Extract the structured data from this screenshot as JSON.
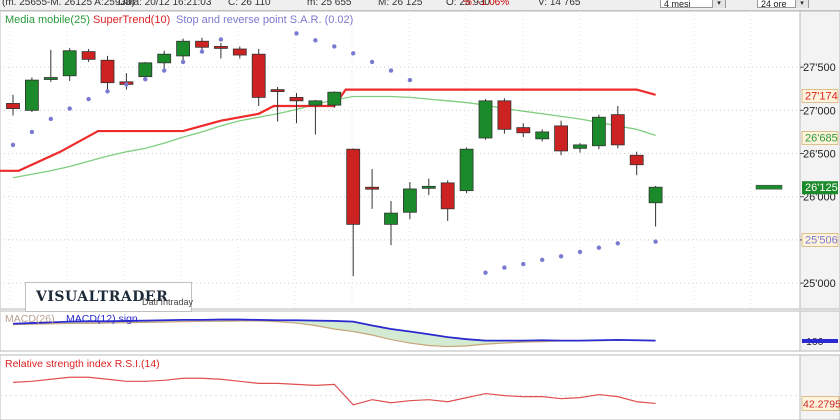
{
  "toolbar": {
    "quote": "(m. 25655-M. 26125 A:25930)",
    "date": "Data: 20/12 16:21:03",
    "close": "C: 26 110",
    "min": "m: 25 655",
    "max": "M: 26 125",
    "open": "O: 25 930",
    "change": "%: -1.06%",
    "volume": "V: 14 765",
    "period_select": "4 mesi",
    "interval_select": "24 ore"
  },
  "brand": {
    "logo": "VISUALTRADER",
    "data_source": "Dati Intraday"
  },
  "colors": {
    "up": "#1a8a2a",
    "down": "#cc2222",
    "ma": "#7fce7f",
    "supertrend": "#ee2a2a",
    "sar": "#7a7ad0",
    "macd": "#2a2ad0",
    "signal": "#c8a57a",
    "rsi": "#e05050",
    "hist": "#bfe3bf"
  },
  "chart_data": {
    "type": "candlestick",
    "legend": [
      {
        "name": "Media mobile(25)",
        "color": "#2a9a3a"
      },
      {
        "name": "SuperTrend(10)",
        "color": "#dd2222"
      },
      {
        "name": "Stop and reverse point S.A.R. (0.02)",
        "color": "#7a7ad0"
      }
    ],
    "y_ticks": [
      25000,
      25500,
      26000,
      26500,
      27000,
      27500
    ],
    "y_tick_labels": [
      "25'000",
      "",
      "26'000",
      "26'500",
      "27'000",
      "27'500"
    ],
    "ylim": [
      24700,
      28150
    ],
    "candles": [
      {
        "o": 27080,
        "h": 27180,
        "l": 26940,
        "c": 27020
      },
      {
        "o": 27000,
        "h": 27380,
        "l": 26980,
        "c": 27350
      },
      {
        "o": 27360,
        "h": 27700,
        "l": 27330,
        "c": 27380
      },
      {
        "o": 27400,
        "h": 27720,
        "l": 27340,
        "c": 27690
      },
      {
        "o": 27680,
        "h": 27710,
        "l": 27560,
        "c": 27590
      },
      {
        "o": 27580,
        "h": 27630,
        "l": 27220,
        "c": 27320
      },
      {
        "o": 27330,
        "h": 27430,
        "l": 27240,
        "c": 27300
      },
      {
        "o": 27390,
        "h": 27560,
        "l": 27380,
        "c": 27550
      },
      {
        "o": 27550,
        "h": 27690,
        "l": 27480,
        "c": 27650
      },
      {
        "o": 27630,
        "h": 27830,
        "l": 27580,
        "c": 27800
      },
      {
        "o": 27800,
        "h": 27840,
        "l": 27700,
        "c": 27730
      },
      {
        "o": 27740,
        "h": 27780,
        "l": 27600,
        "c": 27720
      },
      {
        "o": 27710,
        "h": 27740,
        "l": 27600,
        "c": 27640
      },
      {
        "o": 27650,
        "h": 27710,
        "l": 27050,
        "c": 27150
      },
      {
        "o": 27240,
        "h": 27270,
        "l": 26870,
        "c": 27220
      },
      {
        "o": 27150,
        "h": 27200,
        "l": 26850,
        "c": 27110
      },
      {
        "o": 27060,
        "h": 27120,
        "l": 26720,
        "c": 27110
      },
      {
        "o": 27060,
        "h": 27220,
        "l": 27030,
        "c": 27210
      },
      {
        "o": 26550,
        "h": 26560,
        "l": 25080,
        "c": 25680
      },
      {
        "o": 26110,
        "h": 26320,
        "l": 25860,
        "c": 26090
      },
      {
        "o": 25680,
        "h": 25950,
        "l": 25440,
        "c": 25810
      },
      {
        "o": 25820,
        "h": 26170,
        "l": 25740,
        "c": 26090
      },
      {
        "o": 26110,
        "h": 26210,
        "l": 26020,
        "c": 26120
      },
      {
        "o": 26160,
        "h": 26190,
        "l": 25720,
        "c": 25860
      },
      {
        "o": 26070,
        "h": 26570,
        "l": 26040,
        "c": 26550
      },
      {
        "o": 26680,
        "h": 27130,
        "l": 26660,
        "c": 27110
      },
      {
        "o": 27110,
        "h": 27140,
        "l": 26730,
        "c": 26780
      },
      {
        "o": 26800,
        "h": 26850,
        "l": 26690,
        "c": 26740
      },
      {
        "o": 26670,
        "h": 26780,
        "l": 26640,
        "c": 26750
      },
      {
        "o": 26820,
        "h": 26880,
        "l": 26480,
        "c": 26530
      },
      {
        "o": 26560,
        "h": 26620,
        "l": 26510,
        "c": 26600
      },
      {
        "o": 26590,
        "h": 26950,
        "l": 26550,
        "c": 26920
      },
      {
        "o": 26950,
        "h": 27050,
        "l": 26560,
        "c": 26600
      },
      {
        "o": 26480,
        "h": 26520,
        "l": 26250,
        "c": 26370
      },
      {
        "o": 25930,
        "h": 26125,
        "l": 25655,
        "c": 26110
      }
    ],
    "moving_average": [
      26220,
      26260,
      26300,
      26350,
      26410,
      26470,
      26520,
      26560,
      26620,
      26690,
      26750,
      26820,
      26880,
      26920,
      26960,
      27010,
      27070,
      27120,
      27160,
      27160,
      27160,
      27150,
      27130,
      27110,
      27090,
      27060,
      27020,
      26990,
      26960,
      26930,
      26900,
      26860,
      26820,
      26780,
      26710
    ],
    "supertrend": [
      26300,
      26300,
      26520,
      26760,
      26760,
      26760,
      26760,
      26760,
      26760,
      26760,
      26760,
      26760,
      26880,
      26960,
      26960,
      26960,
      27050,
      27050,
      27050,
      27050,
      27050,
      27050,
      27050,
      27050,
      27050,
      27050,
      27050,
      27240,
      27240,
      27240,
      27240,
      27240,
      27240,
      27240,
      27240,
      27240,
      27180
    ],
    "supertrend_x": [
      0,
      0.7,
      3.5,
      5.5,
      6,
      7,
      8,
      9,
      10,
      11,
      11.4,
      12,
      13,
      14,
      15,
      16,
      17,
      17.5,
      18,
      19,
      20,
      21,
      22,
      23,
      24,
      25,
      17.4,
      17.6,
      19,
      21,
      23,
      25,
      27,
      29,
      31,
      33,
      34
    ],
    "sar": [
      26600,
      26750,
      26900,
      27020,
      27130,
      27220,
      27300,
      27360,
      27460,
      27560,
      27680,
      27820,
      27890,
      27810,
      27740,
      27660,
      27560,
      27460,
      27350,
      25120,
      25180,
      25220,
      25270,
      25310,
      25360,
      25410,
      25460,
      25480
    ],
    "sar_x": [
      0,
      1,
      2,
      3,
      4,
      5,
      6,
      7,
      8,
      9,
      10,
      11,
      15,
      16,
      17,
      18,
      19,
      20,
      21,
      25,
      26,
      27,
      28,
      29,
      30,
      31,
      32,
      34
    ],
    "last_label": "26'125",
    "price_tags": [
      {
        "value": 27174,
        "label": "27'174",
        "color": "#dd2222"
      },
      {
        "value": 26685,
        "label": "26'685",
        "color": "#2a9a3a"
      },
      {
        "value": 25506,
        "label": "25'506",
        "color": "#7a7ad0"
      }
    ],
    "macd_panel": {
      "legend_a": "MACD(26)",
      "legend_b": "MACD(12) sign",
      "tick_label": "100",
      "macd": [
        0.6,
        0.62,
        0.64,
        0.66,
        0.67,
        0.67,
        0.68,
        0.69,
        0.7,
        0.71,
        0.71,
        0.72,
        0.72,
        0.71,
        0.7,
        0.7,
        0.69,
        0.68,
        0.66,
        0.55,
        0.45,
        0.38,
        0.3,
        0.22,
        0.16,
        0.12,
        0.12,
        0.12,
        0.13,
        0.12,
        0.12,
        0.13,
        0.14,
        0.13,
        0.12
      ],
      "signal": [
        0.58,
        0.59,
        0.6,
        0.61,
        0.61,
        0.62,
        0.63,
        0.64,
        0.65,
        0.66,
        0.67,
        0.67,
        0.68,
        0.68,
        0.66,
        0.62,
        0.55,
        0.45,
        0.38,
        0.28,
        0.15,
        0.05,
        -0.02,
        -0.05,
        -0.03,
        0.02,
        0.05,
        0.08,
        0.09,
        0.11,
        0.12,
        0.12,
        0.13,
        0.13,
        0.12
      ]
    },
    "rsi_panel": {
      "legend": "Relative strength index R.S.I.(14)",
      "last_label": "42.2795",
      "values": [
        63,
        64,
        66,
        68,
        68,
        66,
        64,
        64,
        65,
        67,
        67,
        66,
        64,
        62,
        62,
        61,
        60,
        61,
        41,
        46,
        43,
        45,
        46,
        44,
        48,
        52,
        50,
        49,
        49,
        47,
        48,
        51,
        49,
        44,
        42.3
      ]
    }
  }
}
